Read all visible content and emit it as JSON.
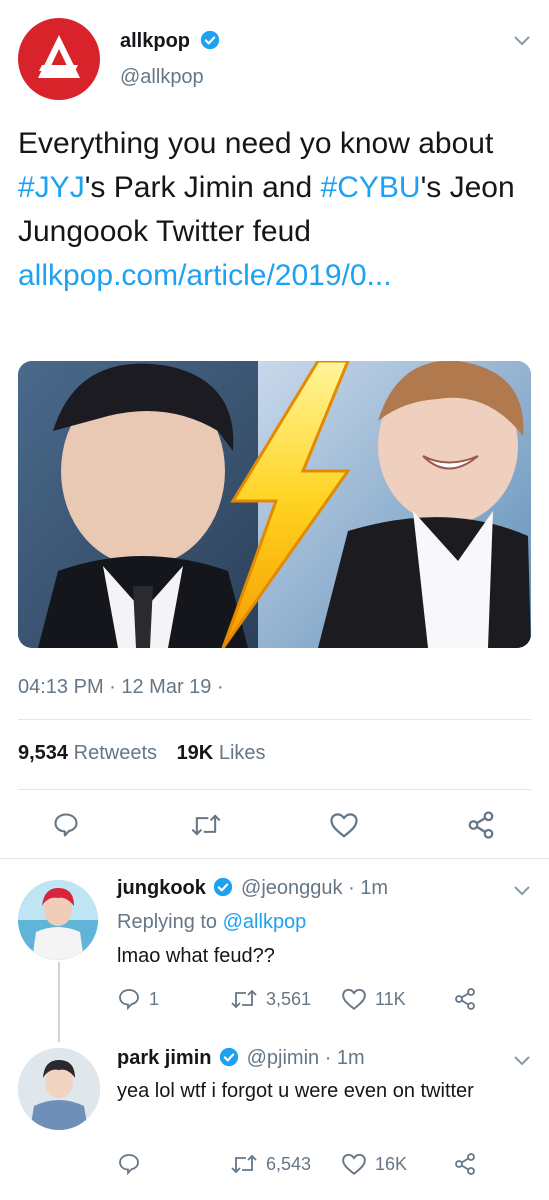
{
  "tweet": {
    "display_name": "allkpop",
    "handle": "@allkpop",
    "text_parts": [
      {
        "text": "Everything you need yo know about ",
        "type": "text"
      },
      {
        "text": "#JYJ",
        "type": "link"
      },
      {
        "text": "'s Park Jimin and ",
        "type": "text"
      },
      {
        "text": "#CYBU",
        "type": "link"
      },
      {
        "text": "'s Jeon Jungoook Twitter feud ",
        "type": "text"
      },
      {
        "text": "allkpop.com/article/2019/0...",
        "type": "link"
      }
    ],
    "timestamp": "04:13 PM · 12 Mar 19 ·",
    "retweets_count": "9,534",
    "retweets_label": "Retweets",
    "likes_count": "19K",
    "likes_label": "Likes"
  },
  "replies": [
    {
      "display_name": "jungkook",
      "handle": "@jeongguk",
      "time": "· 1m",
      "replying_prefix": "Replying to",
      "replying_to": "@allkpop",
      "text": "lmao what feud??",
      "reply_count": "1",
      "retweet_count": "3,561",
      "like_count": "11K"
    },
    {
      "display_name": "park jimin",
      "handle": "@pjimin",
      "time": "· 1m",
      "text": "yea lol wtf i forgot u were even on twitter",
      "reply_count": "",
      "retweet_count": "6,543",
      "like_count": "16K"
    }
  ],
  "colors": {
    "brand_red": "#d8232a",
    "link_blue": "#1da1f2",
    "muted": "#657786"
  }
}
